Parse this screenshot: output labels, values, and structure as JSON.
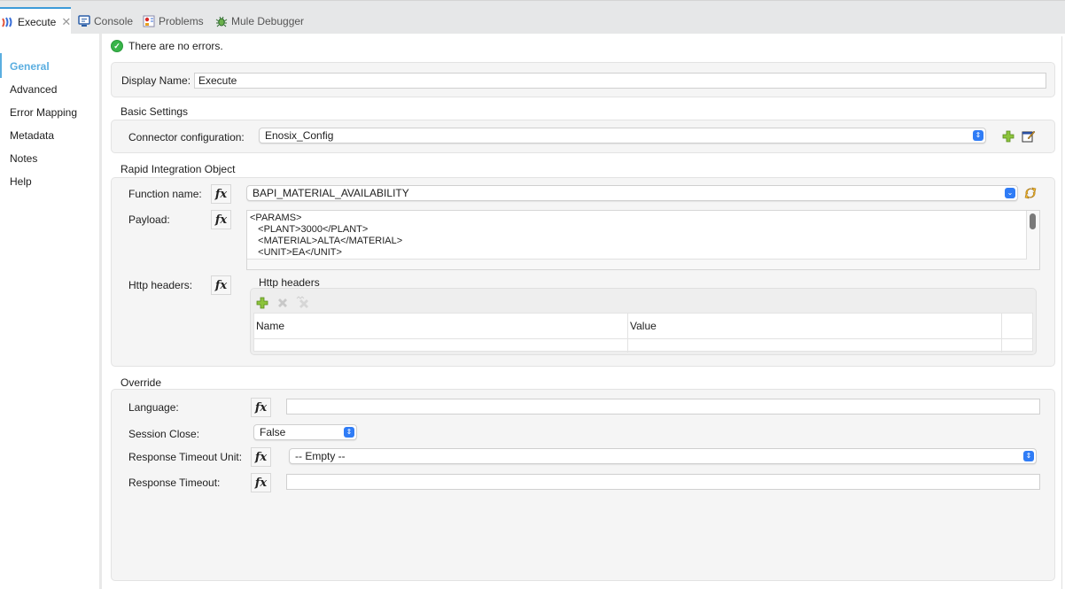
{
  "tabs": [
    {
      "label": "Execute",
      "icon": "mule-connector-icon",
      "active": true,
      "closable": true
    },
    {
      "label": "Console",
      "icon": "console-icon",
      "active": false
    },
    {
      "label": "Problems",
      "icon": "problems-icon",
      "active": false
    },
    {
      "label": "Mule Debugger",
      "icon": "bug-icon",
      "active": false
    }
  ],
  "status": {
    "icon": "check-circle-icon",
    "text": "There are no errors.",
    "color": "#38b449"
  },
  "sidebar": {
    "items": [
      {
        "label": "General",
        "active": true
      },
      {
        "label": "Advanced"
      },
      {
        "label": "Error Mapping"
      },
      {
        "label": "Metadata"
      },
      {
        "label": "Notes"
      },
      {
        "label": "Help"
      }
    ],
    "accent": "#5aaee0"
  },
  "general": {
    "display_name_label": "Display Name:",
    "display_name_value": "Execute"
  },
  "basic_settings": {
    "title": "Basic Settings",
    "connector_config_label": "Connector configuration:",
    "connector_config_value": "Enosix_Config",
    "add_icon": "plus-icon",
    "edit_icon": "edit-icon"
  },
  "rio": {
    "title": "Rapid Integration Object",
    "function_name_label": "Function name:",
    "function_name_value": "BAPI_MATERIAL_AVAILABILITY",
    "refresh_icon": "refresh-icon",
    "payload_label": "Payload:",
    "payload_value": "<PARAMS>\n   <PLANT>3000</PLANT>\n   <MATERIAL>ALTA</MATERIAL>\n   <UNIT>EA</UNIT>",
    "http_headers_label": "Http headers:",
    "http_headers_group_title": "Http headers",
    "http_headers_columns": [
      "Name",
      "Value"
    ],
    "http_headers_rows": []
  },
  "override": {
    "title": "Override",
    "language_label": "Language:",
    "language_value": "",
    "session_close_label": "Session Close:",
    "session_close_value": "False",
    "response_timeout_unit_label": "Response Timeout Unit:",
    "response_timeout_unit_value": "-- Empty --",
    "response_timeout_label": "Response Timeout:",
    "response_timeout_value": ""
  },
  "fx_label": "fx",
  "accent_blue": "#2f7cf6"
}
